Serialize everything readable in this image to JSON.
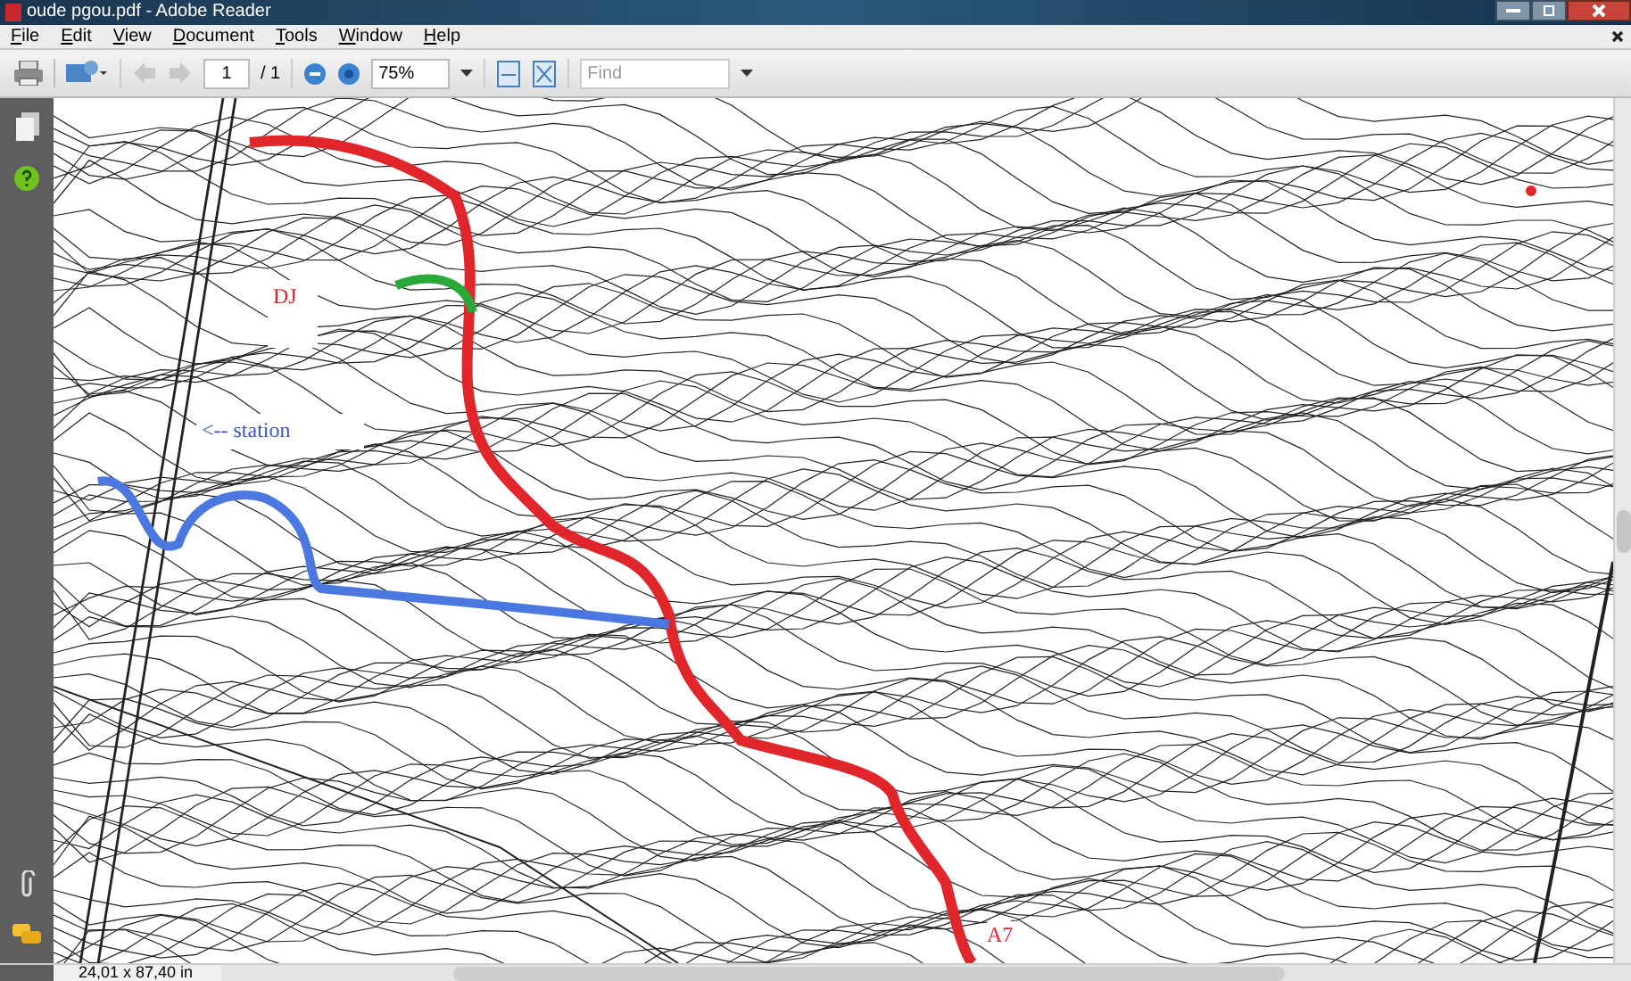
{
  "window": {
    "title": "oude pgou.pdf - Adobe Reader"
  },
  "menu": [
    {
      "label": "File"
    },
    {
      "label": "Edit"
    },
    {
      "label": "View"
    },
    {
      "label": "Document"
    },
    {
      "label": "Tools"
    },
    {
      "label": "Window"
    },
    {
      "label": "Help"
    }
  ],
  "toolbar": {
    "previous_page": {
      "disabled": true
    },
    "next_page": {
      "disabled": true
    },
    "page_number": "1",
    "page_total": "/ 1",
    "zoom": "75%",
    "find": {
      "placeholder": "Find"
    }
  },
  "document": {
    "labels": [
      {
        "kind": "boxed",
        "text": "DJ",
        "color": "#e0262a"
      },
      {
        "kind": "boxed",
        "text": "<-- station",
        "color": "#3a55c8"
      },
      {
        "kind": "plain",
        "text": "A7",
        "color": "#e0262a"
      }
    ]
  },
  "status_bar": {
    "page_size": "24,01 x 87,40 in"
  }
}
